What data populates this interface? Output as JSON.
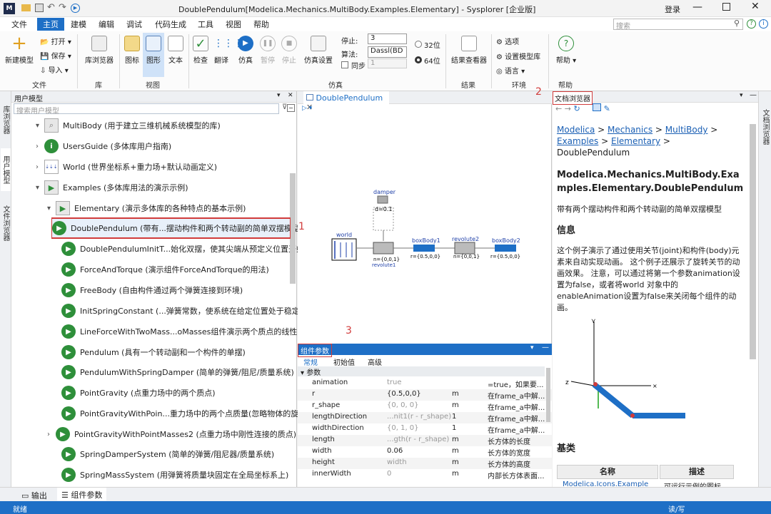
{
  "window": {
    "title": "DoublePendulum[Modelica.Mechanics.MultiBody.Examples.Elementary] - Sysplorer [企业版]",
    "login": "登录"
  },
  "menu": [
    "文件",
    "主页",
    "建模",
    "编辑",
    "调试",
    "代码生成",
    "工具",
    "视图",
    "帮助"
  ],
  "search_placeholder": "搜索",
  "ribbon": {
    "new_model": "新建模型",
    "open": "打开",
    "save": "保存",
    "import": "导入",
    "group_file": "文件",
    "lib_browser": "库浏览器",
    "group_lib": "库",
    "icon": "图标",
    "diagram": "图形",
    "text": "文本",
    "group_view": "视图",
    "check": "检查",
    "translate": "翻译",
    "simulate": "仿真",
    "pause": "暂停",
    "stop": "停止",
    "sim_settings": "仿真设置",
    "group_sim": "仿真",
    "stop_label": "停止:",
    "stop_value": "3",
    "algo_label": "算法:",
    "algo_value": "Dassl(BD",
    "sync_label": "同步",
    "sync_value": "1",
    "bit32": "32位",
    "bit64": "64位",
    "result_viewer": "结果查看器",
    "group_result": "结果",
    "options": "选项",
    "model_lib_settings": "设置模型库",
    "language": "语言",
    "group_env": "环境",
    "help": "帮助",
    "group_help": "帮助"
  },
  "left_panel": {
    "title": "用户模型",
    "search_placeholder": "搜索用户模型",
    "tree": [
      {
        "label": "MultiBody (用于建立三维机械系统模型的库)"
      },
      {
        "label": "UsersGuide (多体库用户指南)"
      },
      {
        "label": "World (世界坐标系+重力场+默认动画定义)"
      },
      {
        "label": "Examples (多体库用法的演示示例)"
      },
      {
        "label": "Elementary (演示多体库的各种特点的基本示例)"
      },
      {
        "label": "DoublePendulum (带有...摆动构件和两个转动副的简单双摆模型)"
      },
      {
        "label": "DoublePendulumInitT...始化双摆，使其尖端从预定义位置开始。)"
      },
      {
        "label": "ForceAndTorque (演示组件ForceAndTorque的用法)"
      },
      {
        "label": "FreeBody (自由构件通过两个弹簧连接到环境)"
      },
      {
        "label": "InitSpringConstant (...弹簧常数，使系统在给定位置处于稳定状态)"
      },
      {
        "label": "LineForceWithTwoMass...oMasses组件演示两个质点的线性力)"
      },
      {
        "label": "Pendulum (具有一个转动副和一个构件的单摆)"
      },
      {
        "label": "PendulumWithSpringDamper (简单的弹簧/阻尼/质量系统)"
      },
      {
        "label": "PointGravity (点重力场中的两个质点)"
      },
      {
        "label": "PointGravityWithPoin...重力场中的两个点质量(忽略物体的旋转))"
      },
      {
        "label": "PointGravityWithPointMasses2 (点重力场中刚性连接的质点)"
      },
      {
        "label": "SpringDamperSystem (简单的弹簧/阻尼器/质量系统)"
      },
      {
        "label": "SpringMassSystem (用弹簧将质量块固定在全局坐标系上)"
      }
    ]
  },
  "side_tabs": {
    "lib_browser": "库浏览器",
    "user_models": "用户模型",
    "file_browser": "文件浏览器",
    "doc_browser": "文档浏览器"
  },
  "center": {
    "tab": "DoublePendulum",
    "diagram": {
      "damper": "damper",
      "d": "d=0.1",
      "world": "world",
      "revolute1": "revolute1",
      "n1": "n={0,0,1}",
      "boxBody1": "boxBody1",
      "r1": "r={0.5,0,0}",
      "revolute2": "revolute2",
      "n2": "n={0,0,1}",
      "boxBody2": "boxBody2",
      "r2": "r={0.5,0,0}"
    },
    "params_title": "组件参数",
    "param_tabs": [
      "常规",
      "初始值",
      "高级"
    ],
    "param_section": "参数",
    "params": [
      {
        "name": "animation",
        "value": "true",
        "unit": "",
        "desc": "=true，如果要..."
      },
      {
        "name": "r",
        "value": "{0.5,0,0}",
        "unit": "m",
        "desc": "在frame_a中解..."
      },
      {
        "name": "r_shape",
        "value": "{0, 0, 0}",
        "unit": "m",
        "desc": "在frame_a中解..."
      },
      {
        "name": "lengthDirection",
        "value": "...nit1(r - r_shape)",
        "unit": "1",
        "desc": "在frame_a中解..."
      },
      {
        "name": "widthDirection",
        "value": "{0, 1, 0}",
        "unit": "1",
        "desc": "在frame_a中解..."
      },
      {
        "name": "length",
        "value": "...gth(r - r_shape)",
        "unit": "m",
        "desc": "长方体的长度"
      },
      {
        "name": "width",
        "value": "0.06",
        "unit": "m",
        "desc": "长方体的宽度"
      },
      {
        "name": "height",
        "value": "width",
        "unit": "m",
        "desc": "长方体的高度"
      },
      {
        "name": "innerWidth",
        "value": "0",
        "unit": "m",
        "desc": "内部长方体表面..."
      }
    ]
  },
  "doc": {
    "title": "文档浏览器",
    "breadcrumb": [
      "Modelica",
      "Mechanics",
      "MultiBody",
      "Examples",
      "Elementary"
    ],
    "current": "DoublePendulum",
    "heading": "Modelica.Mechanics.MultiBody.Examples.Elementary.DoublePendulum",
    "summary": "带有两个摆动构件和两个转动副的简单双摆模型",
    "info_title": "信息",
    "info_text": "这个例子演示了通过使用关节(joint)和构件(body)元素来自动实现动画。 这个例子还展示了旋转关节的动画效果。 注意，可以通过将第一个参数animation设置为false，或者将world 对象中的enableAnimation设置为false来关闭每个组件的动画。",
    "base_title": "基类",
    "table_headers": [
      "名称",
      "描述"
    ],
    "table_row": [
      "Modelica.Icons.Example",
      "可运行示例的图标"
    ]
  },
  "annotations": [
    "1",
    "2",
    "3"
  ],
  "bottom_tabs": [
    "输出",
    "组件参数"
  ],
  "status": {
    "left": "就绪",
    "right": "读/写"
  }
}
